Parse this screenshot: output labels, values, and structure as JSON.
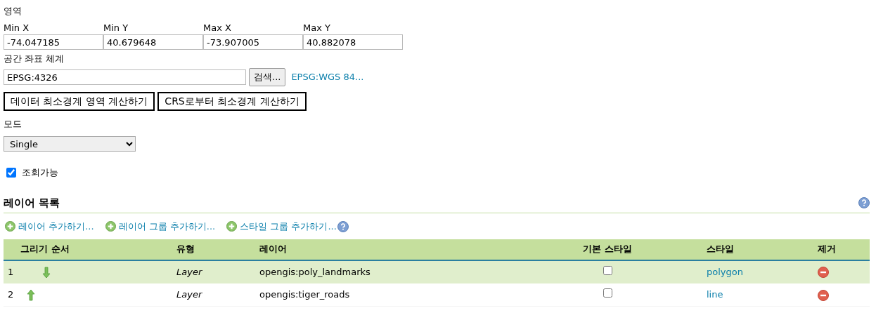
{
  "extent": {
    "title": "영역",
    "fields": [
      {
        "label": "Min X",
        "value": "-74.047185"
      },
      {
        "label": "Min Y",
        "value": "40.679648"
      },
      {
        "label": "Max X",
        "value": "-73.907005"
      },
      {
        "label": "Max Y",
        "value": "40.882078"
      }
    ]
  },
  "crs": {
    "label": "공간 좌표 체계",
    "value": "EPSG:4326",
    "search_button": "검색...",
    "crs_link": "EPSG:WGS 84..."
  },
  "compute_buttons": [
    "데이터 최소경계 영역 계산하기",
    "CRS로부터 최소경계 계산하기"
  ],
  "mode": {
    "label": "모드",
    "value": "Single"
  },
  "queryable": {
    "label": "조회가능",
    "checked": true
  },
  "layer_list": {
    "title": "레이어 목록",
    "actions": [
      "레이어 추가하기...",
      "레이어 그룹 추가하기...",
      "스타일 그룹 추가하기..."
    ],
    "table": {
      "columns": [
        "그리기 순서",
        "유형",
        "레이어",
        "기본 스타일",
        "스타일",
        "제거"
      ],
      "rows": [
        {
          "order": "1",
          "can_move_up": false,
          "can_move_down": true,
          "type": "Layer",
          "layer": "opengis:poly_landmarks",
          "default_style": false,
          "style": "polygon"
        },
        {
          "order": "2",
          "can_move_up": true,
          "can_move_down": false,
          "type": "Layer",
          "layer": "opengis:tiger_roads",
          "default_style": false,
          "style": "line"
        }
      ]
    }
  }
}
